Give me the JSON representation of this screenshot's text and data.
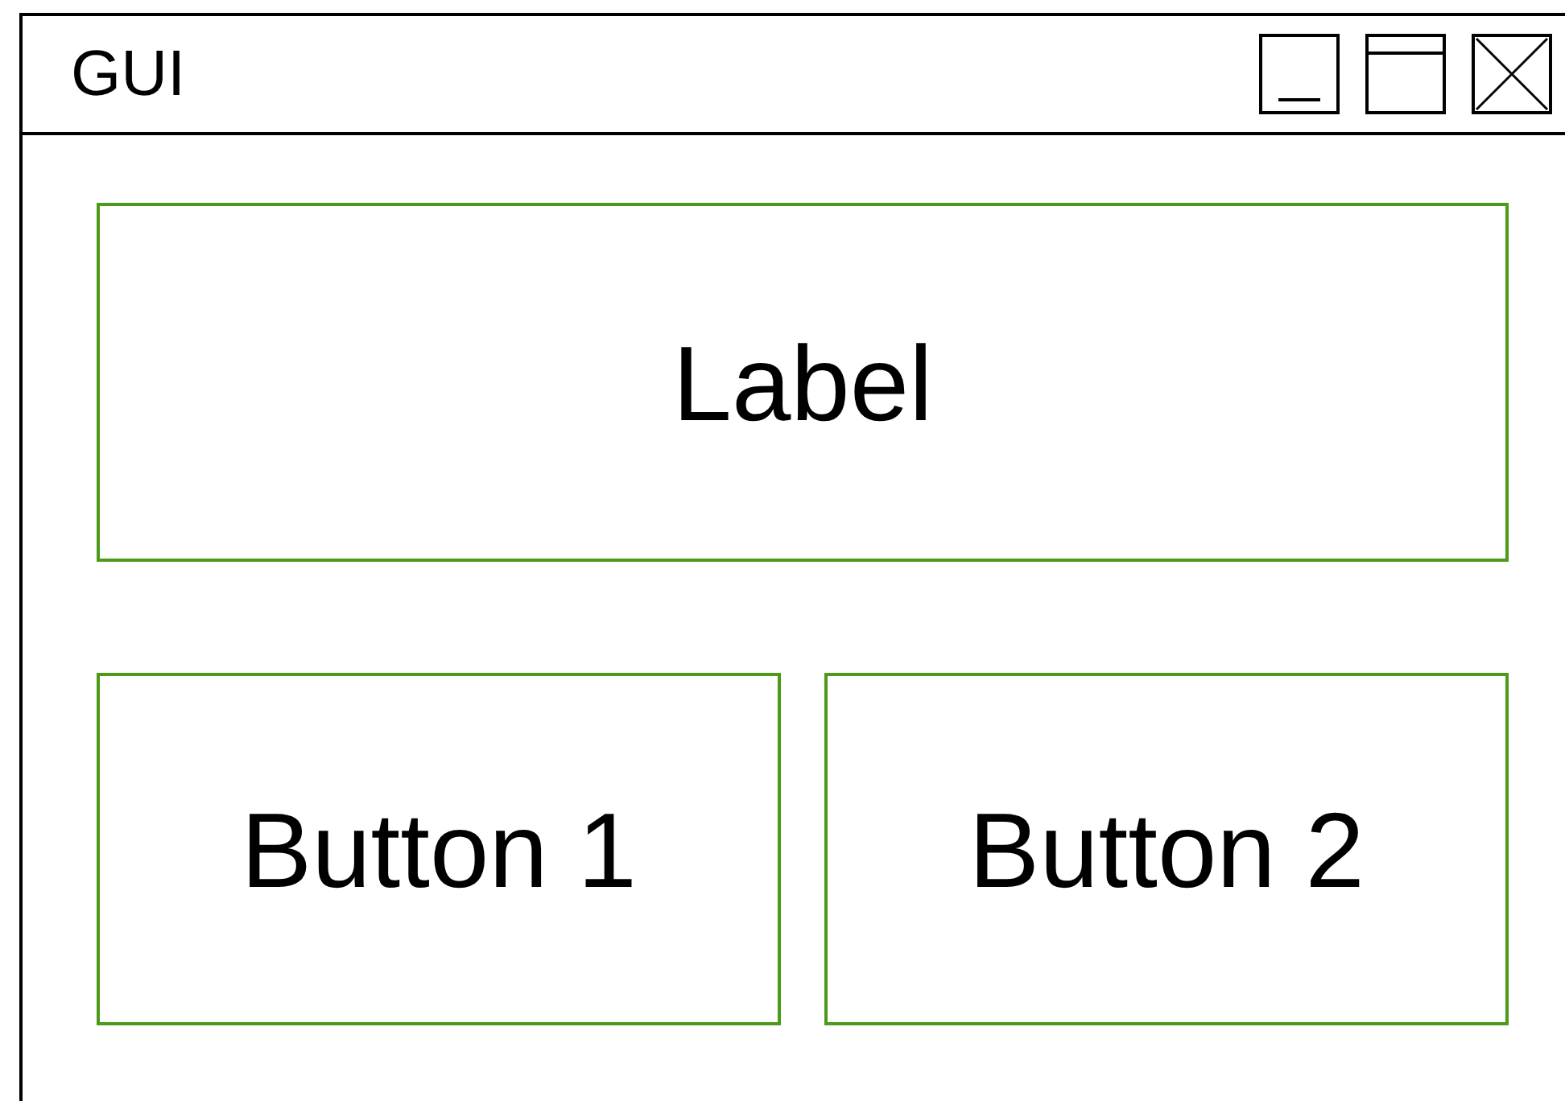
{
  "window": {
    "title": "GUI"
  },
  "label": {
    "text": "Label"
  },
  "buttons": [
    "Button 1",
    "Button 2"
  ]
}
